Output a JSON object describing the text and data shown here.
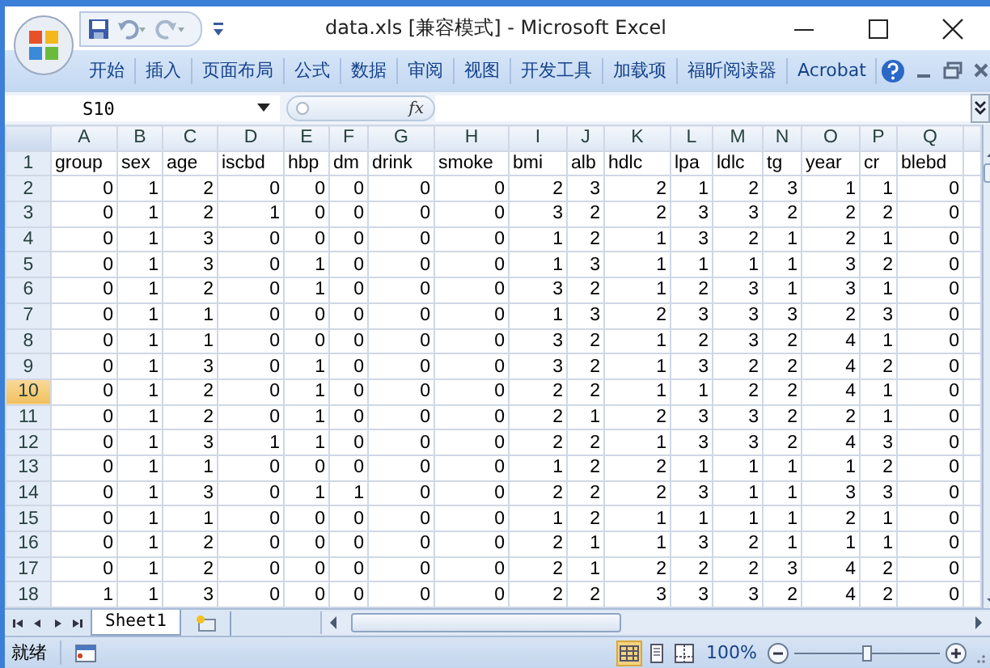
{
  "window": {
    "title": "data.xls  [兼容模式] - Microsoft Excel"
  },
  "ribbon_tabs": [
    {
      "label": "开始",
      "selected": false
    },
    {
      "label": "插入",
      "selected": false
    },
    {
      "label": "页面布局",
      "selected": false
    },
    {
      "label": "公式",
      "selected": false
    },
    {
      "label": "数据",
      "selected": false
    },
    {
      "label": "审阅",
      "selected": false
    },
    {
      "label": "视图",
      "selected": false
    },
    {
      "label": "开发工具",
      "selected": false
    },
    {
      "label": "加载项",
      "selected": false
    },
    {
      "label": "福昕阅读器",
      "selected": false
    },
    {
      "label": "Acrobat",
      "selected": false
    }
  ],
  "formula_bar": {
    "name_box": "S10",
    "fx": "fx"
  },
  "columns": [
    {
      "label": "A",
      "selected": false
    },
    {
      "label": "B",
      "selected": false
    },
    {
      "label": "C",
      "selected": false
    },
    {
      "label": "D",
      "selected": false
    },
    {
      "label": "E",
      "selected": false
    },
    {
      "label": "F",
      "selected": false
    },
    {
      "label": "G",
      "selected": false
    },
    {
      "label": "H",
      "selected": false
    },
    {
      "label": "I",
      "selected": false
    },
    {
      "label": "J",
      "selected": false
    },
    {
      "label": "K",
      "selected": false
    },
    {
      "label": "L",
      "selected": false
    },
    {
      "label": "M",
      "selected": false
    },
    {
      "label": "N",
      "selected": false
    },
    {
      "label": "O",
      "selected": false
    },
    {
      "label": "P",
      "selected": false
    },
    {
      "label": "Q",
      "selected": false
    }
  ],
  "rows": [
    {
      "number": "1",
      "selected": false,
      "kind": "text",
      "cells": [
        "group",
        "sex",
        "age",
        "iscbd",
        "hbp",
        "dm",
        "drink",
        "smoke",
        "bmi",
        "alb",
        "hdlc",
        "lpa",
        "ldlc",
        "tg",
        "year",
        "cr",
        "blebd"
      ]
    },
    {
      "number": "2",
      "selected": false,
      "kind": "number",
      "cells": [
        "0",
        "1",
        "2",
        "0",
        "0",
        "0",
        "0",
        "0",
        "2",
        "3",
        "2",
        "1",
        "2",
        "3",
        "1",
        "1",
        "0"
      ]
    },
    {
      "number": "3",
      "selected": false,
      "kind": "number",
      "cells": [
        "0",
        "1",
        "2",
        "1",
        "0",
        "0",
        "0",
        "0",
        "3",
        "2",
        "2",
        "3",
        "3",
        "2",
        "2",
        "2",
        "0"
      ]
    },
    {
      "number": "4",
      "selected": false,
      "kind": "number",
      "cells": [
        "0",
        "1",
        "3",
        "0",
        "0",
        "0",
        "0",
        "0",
        "1",
        "2",
        "1",
        "3",
        "2",
        "1",
        "2",
        "1",
        "0"
      ]
    },
    {
      "number": "5",
      "selected": false,
      "kind": "number",
      "cells": [
        "0",
        "1",
        "3",
        "0",
        "1",
        "0",
        "0",
        "0",
        "1",
        "3",
        "1",
        "1",
        "1",
        "1",
        "3",
        "2",
        "0"
      ]
    },
    {
      "number": "6",
      "selected": false,
      "kind": "number",
      "cells": [
        "0",
        "1",
        "2",
        "0",
        "1",
        "0",
        "0",
        "0",
        "3",
        "2",
        "1",
        "2",
        "3",
        "1",
        "3",
        "1",
        "0"
      ]
    },
    {
      "number": "7",
      "selected": false,
      "kind": "number",
      "cells": [
        "0",
        "1",
        "1",
        "0",
        "0",
        "0",
        "0",
        "0",
        "1",
        "3",
        "2",
        "3",
        "3",
        "3",
        "2",
        "3",
        "0"
      ]
    },
    {
      "number": "8",
      "selected": false,
      "kind": "number",
      "cells": [
        "0",
        "1",
        "1",
        "0",
        "0",
        "0",
        "0",
        "0",
        "3",
        "2",
        "1",
        "2",
        "3",
        "2",
        "4",
        "1",
        "0"
      ]
    },
    {
      "number": "9",
      "selected": false,
      "kind": "number",
      "cells": [
        "0",
        "1",
        "3",
        "0",
        "1",
        "0",
        "0",
        "0",
        "3",
        "2",
        "1",
        "3",
        "2",
        "2",
        "4",
        "2",
        "0"
      ]
    },
    {
      "number": "10",
      "selected": true,
      "kind": "number",
      "cells": [
        "0",
        "1",
        "2",
        "0",
        "1",
        "0",
        "0",
        "0",
        "2",
        "2",
        "1",
        "1",
        "2",
        "2",
        "4",
        "1",
        "0"
      ]
    },
    {
      "number": "11",
      "selected": false,
      "kind": "number",
      "cells": [
        "0",
        "1",
        "2",
        "0",
        "1",
        "0",
        "0",
        "0",
        "2",
        "1",
        "2",
        "3",
        "3",
        "2",
        "2",
        "1",
        "0"
      ]
    },
    {
      "number": "12",
      "selected": false,
      "kind": "number",
      "cells": [
        "0",
        "1",
        "3",
        "1",
        "1",
        "0",
        "0",
        "0",
        "2",
        "2",
        "1",
        "3",
        "3",
        "2",
        "4",
        "3",
        "0"
      ]
    },
    {
      "number": "13",
      "selected": false,
      "kind": "number",
      "cells": [
        "0",
        "1",
        "1",
        "0",
        "0",
        "0",
        "0",
        "0",
        "1",
        "2",
        "2",
        "1",
        "1",
        "1",
        "1",
        "2",
        "0"
      ]
    },
    {
      "number": "14",
      "selected": false,
      "kind": "number",
      "cells": [
        "0",
        "1",
        "3",
        "0",
        "1",
        "1",
        "0",
        "0",
        "2",
        "2",
        "2",
        "3",
        "1",
        "1",
        "3",
        "3",
        "0"
      ]
    },
    {
      "number": "15",
      "selected": false,
      "kind": "number",
      "cells": [
        "0",
        "1",
        "1",
        "0",
        "0",
        "0",
        "0",
        "0",
        "1",
        "2",
        "1",
        "1",
        "1",
        "1",
        "2",
        "1",
        "0"
      ]
    },
    {
      "number": "16",
      "selected": false,
      "kind": "number",
      "cells": [
        "0",
        "1",
        "2",
        "0",
        "0",
        "0",
        "0",
        "0",
        "2",
        "1",
        "1",
        "3",
        "2",
        "1",
        "1",
        "1",
        "0"
      ]
    },
    {
      "number": "17",
      "selected": false,
      "kind": "number",
      "cells": [
        "0",
        "1",
        "2",
        "0",
        "0",
        "0",
        "0",
        "0",
        "2",
        "1",
        "2",
        "2",
        "2",
        "3",
        "4",
        "2",
        "0"
      ]
    },
    {
      "number": "18",
      "selected": false,
      "kind": "number",
      "cells": [
        "1",
        "1",
        "3",
        "0",
        "0",
        "0",
        "0",
        "0",
        "2",
        "2",
        "3",
        "3",
        "3",
        "2",
        "4",
        "2",
        "0"
      ]
    }
  ],
  "sheet_tabs": [
    {
      "label": "Sheet1",
      "selected": true
    }
  ],
  "status_bar": {
    "status": "就绪",
    "views": [
      {
        "kind": "normal",
        "selected": true
      },
      {
        "kind": "layout",
        "selected": false
      },
      {
        "kind": "pagebreak",
        "selected": false
      }
    ],
    "zoom": "100%",
    "zoom_level": {
      "level": 0.5
    }
  }
}
